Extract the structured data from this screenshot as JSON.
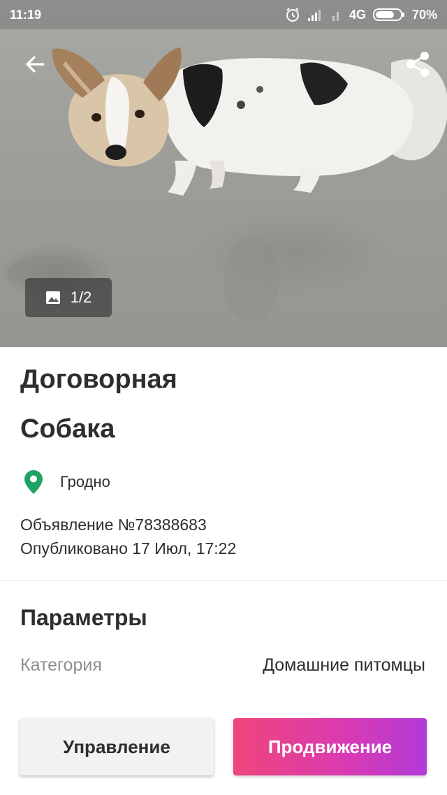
{
  "status_bar": {
    "time": "11:19",
    "network": "4G",
    "battery": "70%",
    "icons": [
      "alarm-icon",
      "signal-icon",
      "signal-icon",
      "battery-icon"
    ]
  },
  "toolbar": {
    "back_icon": "arrow-back-icon",
    "share_icon": "share-icon"
  },
  "gallery": {
    "counter": "1/2",
    "counter_icon": "image-icon"
  },
  "listing": {
    "price": "Договорная",
    "title": "Собака",
    "location_icon": "location-pin-icon",
    "location": "Гродно",
    "ad_number": "Объявление №78388683",
    "published": "Опубликовано 17 Июл, 17:22"
  },
  "params": {
    "heading": "Параметры",
    "rows": [
      {
        "key": "Категория",
        "value": "Домашние питомцы"
      }
    ]
  },
  "actions": {
    "manage_label": "Управление",
    "promote_label": "Продвижение"
  },
  "colors": {
    "accent_pin": "#1ea362",
    "promote_gradient_start": "#f0457a",
    "promote_gradient_end": "#b03ad8"
  }
}
